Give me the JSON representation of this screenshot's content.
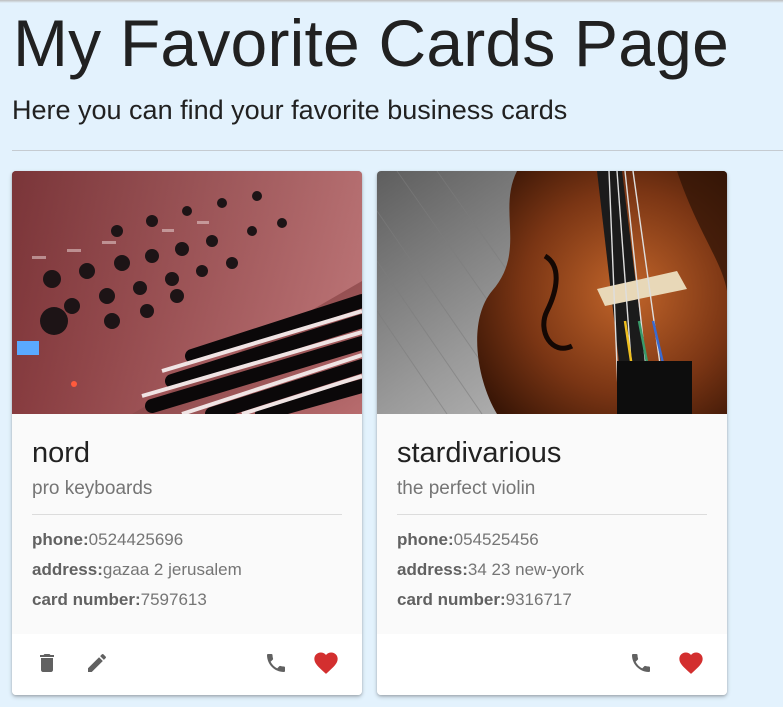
{
  "header": {
    "title": "My Favorite Cards Page",
    "subtitle": "Here you can find your favorite business cards"
  },
  "colors": {
    "page_background": "#e3f2fd",
    "favorite_heart": "#d32f2f",
    "action_icon": "#616161"
  },
  "cards": [
    {
      "title": "nord",
      "subtitle": "pro keyboards",
      "image": "synthesizer keyboard photo",
      "phone_label": "phone:",
      "phone": "0524425696",
      "address_label": "address:",
      "address": "gazaa 2 jerusalem",
      "card_number_label": "card number:",
      "card_number": "7597613",
      "actions": [
        "delete-icon",
        "edit-icon",
        "phone-icon",
        "heart-icon"
      ]
    },
    {
      "title": "stardivarious",
      "subtitle": "the perfect violin",
      "image": "violin photo",
      "phone_label": "phone:",
      "phone": "054525456",
      "address_label": "address:",
      "address": "34 23 new-york",
      "card_number_label": "card number:",
      "card_number": "9316717",
      "actions": [
        "phone-icon",
        "heart-icon"
      ]
    }
  ]
}
